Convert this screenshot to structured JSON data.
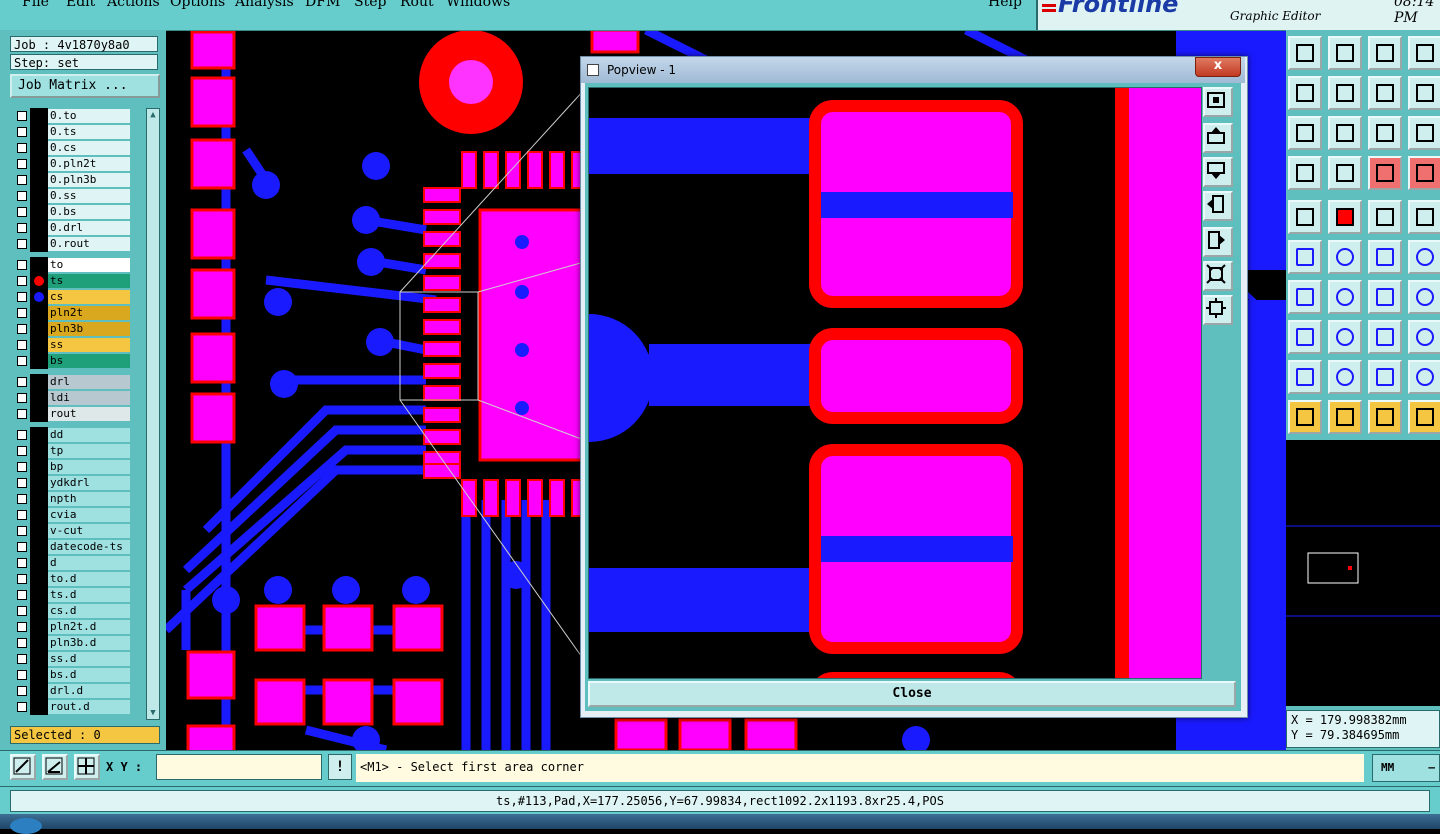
{
  "menu": {
    "items": [
      "File",
      "Edit",
      "Actions",
      "Options",
      "Analysis",
      "DFM",
      "Step",
      "Rout",
      "Windows"
    ],
    "help": "Help"
  },
  "brand": {
    "logo": "Frontline",
    "subtitle": "Graphic Editor",
    "clock": "08:14 PM"
  },
  "job": {
    "job_label": "Job : 4v1870y8a0",
    "step_label": "Step: set",
    "matrix_button": "Job Matrix ..."
  },
  "layers": [
    {
      "name": "0.to",
      "color": "#dff4f4"
    },
    {
      "name": "0.ts",
      "color": "#dff4f4"
    },
    {
      "name": "0.cs",
      "color": "#dff4f4"
    },
    {
      "name": "0.pln2t",
      "color": "#dff4f4"
    },
    {
      "name": "0.pln3b",
      "color": "#dff4f4"
    },
    {
      "name": "0.ss",
      "color": "#dff4f4"
    },
    {
      "name": "0.bs",
      "color": "#dff4f4"
    },
    {
      "name": "0.drl",
      "color": "#dff4f4"
    },
    {
      "name": "0.rout",
      "color": "#dff4f4"
    },
    {
      "name": "to",
      "color": "#ffffff"
    },
    {
      "name": "ts",
      "color": "#1fa07a",
      "active": "red"
    },
    {
      "name": "cs",
      "color": "#f5c642",
      "active": "blue"
    },
    {
      "name": "pln2t",
      "color": "#d9a81e"
    },
    {
      "name": "pln3b",
      "color": "#d9a81e"
    },
    {
      "name": "ss",
      "color": "#f5c642"
    },
    {
      "name": "bs",
      "color": "#1fa07a"
    },
    {
      "name": "drl",
      "color": "#b8c8d0"
    },
    {
      "name": "ldi",
      "color": "#b8c8d0"
    },
    {
      "name": "rout",
      "color": "#dfe8e8"
    },
    {
      "name": "dd",
      "color": "#9fe0e0"
    },
    {
      "name": "tp",
      "color": "#9fe0e0"
    },
    {
      "name": "bp",
      "color": "#9fe0e0"
    },
    {
      "name": "ydkdrl",
      "color": "#9fe0e0"
    },
    {
      "name": "npth",
      "color": "#9fe0e0"
    },
    {
      "name": "cvia",
      "color": "#9fe0e0"
    },
    {
      "name": "v-cut",
      "color": "#9fe0e0"
    },
    {
      "name": "datecode-ts",
      "color": "#9fe0e0"
    },
    {
      "name": "d",
      "color": "#9fe0e0"
    },
    {
      "name": "to.d",
      "color": "#9fe0e0"
    },
    {
      "name": "ts.d",
      "color": "#9fe0e0"
    },
    {
      "name": "cs.d",
      "color": "#9fe0e0"
    },
    {
      "name": "pln2t.d",
      "color": "#9fe0e0"
    },
    {
      "name": "pln3b.d",
      "color": "#9fe0e0"
    },
    {
      "name": "ss.d",
      "color": "#9fe0e0"
    },
    {
      "name": "bs.d",
      "color": "#9fe0e0"
    },
    {
      "name": "drl.d",
      "color": "#9fe0e0"
    },
    {
      "name": "rout.d",
      "color": "#9fe0e0"
    }
  ],
  "selected": "Selected : 0",
  "popview": {
    "title": "Popview - 1",
    "close_glyph": "x",
    "close_button": "Close"
  },
  "coords": {
    "x": "X =  179.998382mm",
    "y": "Y =  79.384695mm"
  },
  "command": {
    "xy_label": "X Y :",
    "xy_value": "",
    "bang": "!",
    "prompt": "<M1> - Select first area corner",
    "units": "MM"
  },
  "status": "ts,#113,Pad,X=177.25056,Y=67.99834,rect1092.2x1193.8xr25.4,POS",
  "colors": {
    "panel": "#5fbfbf",
    "board": "#000000",
    "copper_top": "#ff00ff",
    "copper_outline": "#ff0000",
    "trace": "#1a1aff"
  }
}
